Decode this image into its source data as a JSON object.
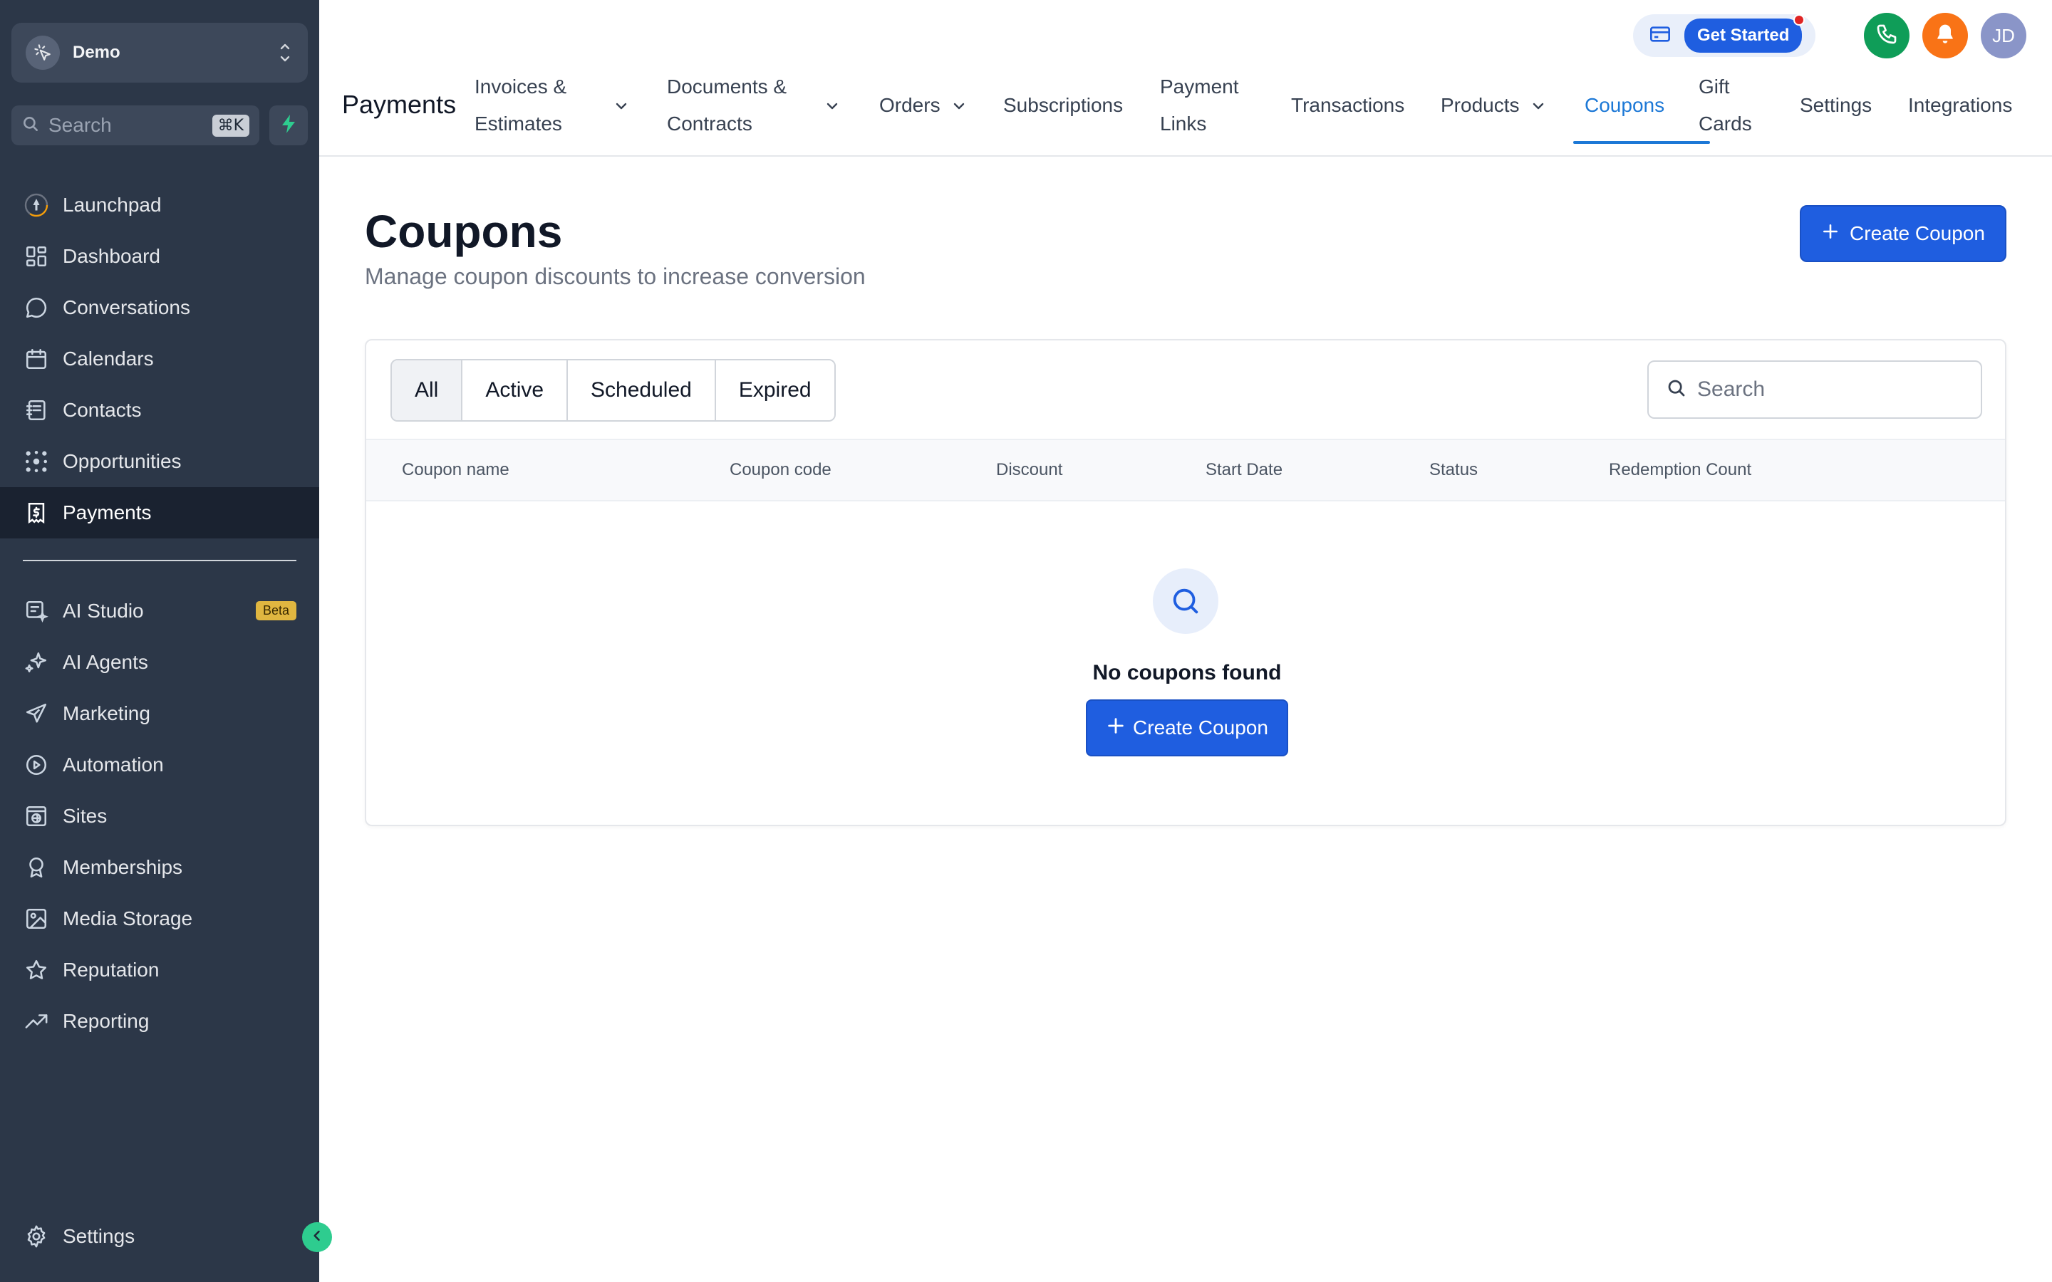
{
  "account": {
    "name": "Demo"
  },
  "sidebar_search": {
    "placeholder": "Search",
    "shortcut": "⌘K"
  },
  "sidebar": {
    "items": [
      {
        "label": "Launchpad",
        "icon": "rocket-icon"
      },
      {
        "label": "Dashboard",
        "icon": "grid-icon"
      },
      {
        "label": "Conversations",
        "icon": "chat-bubble-icon"
      },
      {
        "label": "Calendars",
        "icon": "calendar-icon"
      },
      {
        "label": "Contacts",
        "icon": "contacts-book-icon"
      },
      {
        "label": "Opportunities",
        "icon": "opportunities-icon"
      },
      {
        "label": "Payments",
        "icon": "payments-icon",
        "active": true
      }
    ],
    "items2": [
      {
        "label": "AI Studio",
        "icon": "ai-studio-icon",
        "badge": "Beta"
      },
      {
        "label": "AI Agents",
        "icon": "sparkles-icon"
      },
      {
        "label": "Marketing",
        "icon": "send-icon"
      },
      {
        "label": "Automation",
        "icon": "automation-icon"
      },
      {
        "label": "Sites",
        "icon": "globe-page-icon"
      },
      {
        "label": "Memberships",
        "icon": "award-icon"
      },
      {
        "label": "Media Storage",
        "icon": "image-icon"
      },
      {
        "label": "Reputation",
        "icon": "star-icon"
      },
      {
        "label": "Reporting",
        "icon": "trend-up-icon"
      }
    ],
    "settings_label": "Settings"
  },
  "header": {
    "get_started": "Get Started",
    "avatar_initials": "JD",
    "section_title": "Payments",
    "tabs": [
      {
        "label": "Invoices & Estimates",
        "dropdown": true
      },
      {
        "label": "Documents & Contracts",
        "dropdown": true
      },
      {
        "label": "Orders",
        "dropdown": true
      },
      {
        "label": "Subscriptions"
      },
      {
        "label": "Payment Links"
      },
      {
        "label": "Transactions"
      },
      {
        "label": "Products",
        "dropdown": true
      },
      {
        "label": "Coupons",
        "active": true
      },
      {
        "label": "Gift Cards"
      },
      {
        "label": "Settings"
      },
      {
        "label": "Integrations"
      }
    ]
  },
  "page": {
    "title": "Coupons",
    "subtitle": "Manage coupon discounts to increase conversion",
    "create_button": "Create Coupon"
  },
  "filters": [
    "All",
    "Active",
    "Scheduled",
    "Expired"
  ],
  "active_filter": "All",
  "table_search": {
    "placeholder": "Search"
  },
  "table": {
    "columns": [
      "Coupon name",
      "Coupon code",
      "Discount",
      "Start Date",
      "Status",
      "Redemption Count"
    ]
  },
  "empty_state": {
    "message": "No coupons found",
    "button": "Create Coupon"
  },
  "colors": {
    "sidebar_bg": "#2c3748",
    "primary": "#1f5ee0",
    "active_tab": "#1c78d6",
    "phone": "#0f9d58",
    "bell": "#f97316",
    "collapse": "#2ecc8f",
    "beta_badge": "#e0b640"
  }
}
